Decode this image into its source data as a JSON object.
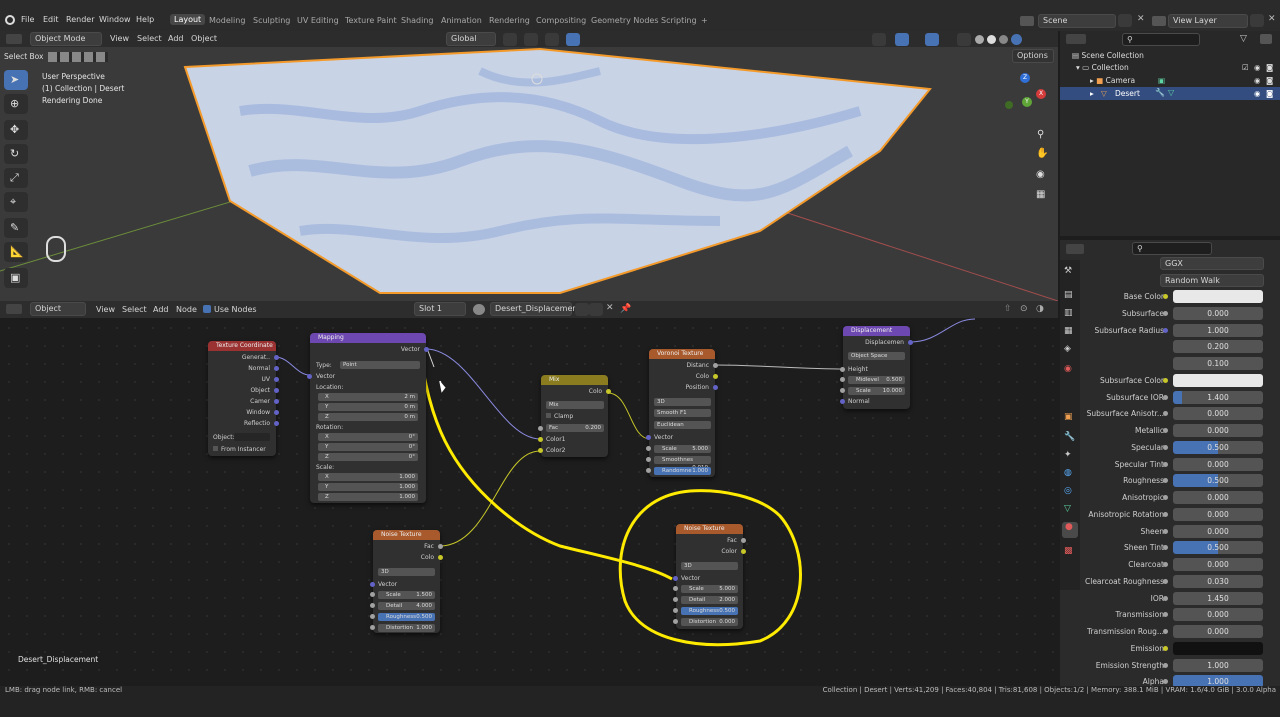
{
  "menu": {
    "items": [
      "File",
      "Edit",
      "Render",
      "Window",
      "Help"
    ]
  },
  "workspaces": [
    "Layout",
    "Modeling",
    "Sculpting",
    "UV Editing",
    "Texture Paint",
    "Shading",
    "Animation",
    "Rendering",
    "Compositing",
    "Geometry Nodes",
    "Scripting",
    "+"
  ],
  "scene": {
    "name": "Scene",
    "view_layer": "View Layer"
  },
  "viewport_header": {
    "select_box": "Select Box",
    "mode": "Object Mode",
    "view": "View",
    "select": "Select",
    "add": "Add",
    "object": "Object",
    "orientation": "Global",
    "options": "Options"
  },
  "viewport_overlay": {
    "line1": "User Perspective",
    "line2": "(1) Collection | Desert",
    "line3": "Rendering Done"
  },
  "gizmo": {
    "x": "X",
    "y": "Y",
    "z": "Z"
  },
  "outliner": {
    "scene_collection": "Scene Collection",
    "collection": "Collection",
    "camera": "Camera",
    "desert": "Desert"
  },
  "node_header": {
    "editor": "Object",
    "view": "View",
    "select": "Select",
    "add": "Add",
    "node": "Node",
    "use_nodes": "Use Nodes",
    "slot": "Slot 1",
    "material": "Desert_Displacement"
  },
  "nodes": {
    "texcoord": {
      "title": "Texture Coordinate",
      "outputs": [
        "Generat..",
        "Normal",
        "UV",
        "Object",
        "Camer",
        "Window",
        "Reflectio"
      ],
      "object_label": "Object:",
      "from_instancer": "From Instancer"
    },
    "mapping": {
      "title": "Mapping",
      "vector_out": "Vector",
      "type_label": "Type:",
      "type_value": "Point",
      "vector_in": "Vector",
      "location": "Location:",
      "rotation": "Rotation:",
      "scale": "Scale:",
      "loc": [
        [
          "X",
          "2 m"
        ],
        [
          "Y",
          "0 m"
        ],
        [
          "Z",
          "0 m"
        ]
      ],
      "rot": [
        [
          "X",
          "0°"
        ],
        [
          "Y",
          "0°"
        ],
        [
          "Z",
          "0°"
        ]
      ],
      "scl": [
        [
          "X",
          "1.000"
        ],
        [
          "Y",
          "1.000"
        ],
        [
          "Z",
          "1.000"
        ]
      ]
    },
    "mix": {
      "title": "Mix",
      "color_out": "Colo",
      "blend": "Mix",
      "clamp": "Clamp",
      "fac_label": "Fac",
      "fac_value": "0.200",
      "color1": "Color1",
      "color2": "Color2"
    },
    "voronoi": {
      "title": "Voronoi Texture",
      "outputs": [
        "Distanc",
        "Colo",
        "Position"
      ],
      "dim": "3D",
      "feature": "Smooth F1",
      "metric": "Euclidean",
      "vector": "Vector",
      "fields": [
        [
          "Scale",
          "5.000"
        ],
        [
          "Smoothnes",
          "0.010"
        ],
        [
          "Randomne",
          "1.000"
        ]
      ]
    },
    "displacement": {
      "title": "Displacement",
      "out": "Displacemen",
      "space": "Object Space",
      "height": "Height",
      "fields": [
        [
          "Midlevel",
          "0.500"
        ],
        [
          "Scale",
          "10.000"
        ]
      ],
      "normal": "Normal"
    },
    "noise1": {
      "title": "Noise Texture",
      "fac": "Fac",
      "color": "Colo",
      "dim": "3D",
      "vector": "Vector",
      "fields": [
        [
          "Scale",
          "1.500"
        ],
        [
          "Detail",
          "4.000"
        ],
        [
          "Roughness",
          "0.500"
        ],
        [
          "Distortion",
          "1.000"
        ]
      ]
    },
    "noise2": {
      "title": "Noise Texture",
      "fac": "Fac",
      "color": "Color",
      "dim": "3D",
      "vector": "Vector",
      "fields": [
        [
          "Scale",
          "5.000"
        ],
        [
          "Detail",
          "2.000"
        ],
        [
          "Roughness",
          "0.500"
        ],
        [
          "Distortion",
          "0.000"
        ]
      ]
    }
  },
  "node_editor_label": "Desert_Displacement",
  "properties": {
    "distribution": "GGX",
    "subsurface_method": "Random Walk",
    "rows": [
      {
        "label": "Base Color",
        "value": "",
        "kind": "white",
        "dot": "col"
      },
      {
        "label": "Subsurface",
        "value": "0.000",
        "kind": "num",
        "dot": "fac"
      },
      {
        "label": "Subsurface Radius",
        "value": "1.000",
        "kind": "num",
        "dot": "vec"
      },
      {
        "label": "",
        "value": "0.200",
        "kind": "num",
        "dot": ""
      },
      {
        "label": "",
        "value": "0.100",
        "kind": "num",
        "dot": ""
      },
      {
        "label": "Subsurface Color",
        "value": "",
        "kind": "white",
        "dot": "col"
      },
      {
        "label": "Subsurface IOR",
        "value": "1.400",
        "kind": "num",
        "dot": "fac"
      },
      {
        "label": "Subsurface Anisotr...",
        "value": "0.000",
        "kind": "num",
        "dot": "fac"
      },
      {
        "label": "Metallic",
        "value": "0.000",
        "kind": "num",
        "dot": "fac"
      },
      {
        "label": "Specular",
        "value": "0.500",
        "kind": "half",
        "dot": "fac"
      },
      {
        "label": "Specular Tint",
        "value": "0.000",
        "kind": "num",
        "dot": "fac"
      },
      {
        "label": "Roughness",
        "value": "0.500",
        "kind": "half",
        "dot": "fac"
      },
      {
        "label": "Anisotropic",
        "value": "0.000",
        "kind": "num",
        "dot": "fac"
      },
      {
        "label": "Anisotropic Rotation",
        "value": "0.000",
        "kind": "num",
        "dot": "fac"
      },
      {
        "label": "Sheen",
        "value": "0.000",
        "kind": "num",
        "dot": "fac"
      },
      {
        "label": "Sheen Tint",
        "value": "0.500",
        "kind": "half",
        "dot": "fac"
      },
      {
        "label": "Clearcoat",
        "value": "0.000",
        "kind": "num",
        "dot": "fac"
      },
      {
        "label": "Clearcoat Roughness",
        "value": "0.030",
        "kind": "num",
        "dot": "fac"
      },
      {
        "label": "IOR",
        "value": "1.450",
        "kind": "num",
        "dot": "fac"
      },
      {
        "label": "Transmission",
        "value": "0.000",
        "kind": "num",
        "dot": "fac"
      },
      {
        "label": "Transmission Roug...",
        "value": "0.000",
        "kind": "num",
        "dot": "fac"
      },
      {
        "label": "Emission",
        "value": "",
        "kind": "black",
        "dot": "col"
      },
      {
        "label": "Emission Strength",
        "value": "1.000",
        "kind": "num",
        "dot": "fac"
      },
      {
        "label": "Alpha",
        "value": "1.000",
        "kind": "full",
        "dot": "fac"
      }
    ]
  },
  "status": {
    "left": "LMB: drag node link, RMB: cancel",
    "right": "Collection | Desert | Verts:41,209 | Faces:40,804 | Tris:81,608 | Objects:1/2 | Memory: 388.1 MiB | VRAM: 1.6/4.0 GiB | 3.0.0 Alpha"
  },
  "colors": {
    "accent": "#4772b3",
    "annotation": "#ffeb00",
    "vector_socket": "#6363c7",
    "color_socket": "#c7c729"
  }
}
